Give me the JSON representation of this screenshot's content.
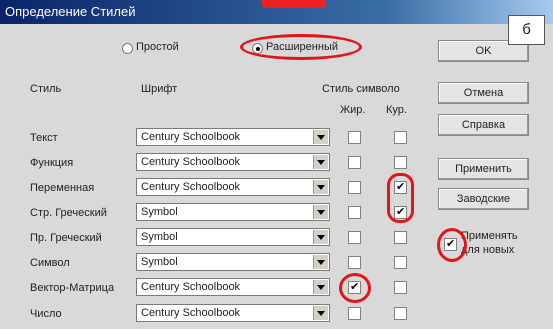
{
  "window": {
    "title": "Определение Стилей"
  },
  "badge": "б",
  "mode": {
    "simple_label": "Простой",
    "extended_label": "Расширенный",
    "selected": "extended"
  },
  "headers": {
    "style": "Стиль",
    "font": "Шрифт",
    "char_style": "Стиль символо",
    "bold": "Жир.",
    "italic": "Кур."
  },
  "rows": [
    {
      "style": "Текст",
      "font": "Century Schoolbook",
      "bold": false,
      "italic": false
    },
    {
      "style": "Функция",
      "font": "Century Schoolbook",
      "bold": false,
      "italic": false
    },
    {
      "style": "Переменная",
      "font": "Century Schoolbook",
      "bold": false,
      "italic": true
    },
    {
      "style": "Стр. Греческий",
      "font": "Symbol",
      "bold": false,
      "italic": true
    },
    {
      "style": "Пр. Греческий",
      "font": "Symbol",
      "bold": false,
      "italic": false
    },
    {
      "style": "Символ",
      "font": "Symbol",
      "bold": false,
      "italic": false
    },
    {
      "style": "Вектор-Матрица",
      "font": "Century Schoolbook",
      "bold": true,
      "italic": false
    },
    {
      "style": "Число",
      "font": "Century Schoolbook",
      "bold": false,
      "italic": false
    }
  ],
  "buttons": {
    "ok": "OK",
    "cancel": "Отмена",
    "help": "Справка",
    "apply": "Применить",
    "factory": "Заводские"
  },
  "apply_new": {
    "line1": "Применять",
    "line2": "для новых",
    "checked": true
  },
  "colors": {
    "highlight": "#e0161c",
    "title_bar": "#0a246a"
  }
}
